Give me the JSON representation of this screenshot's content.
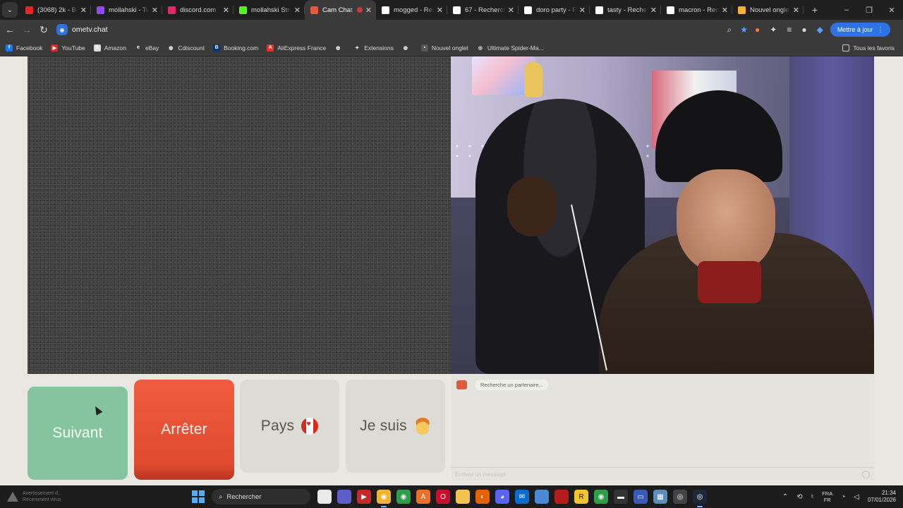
{
  "browser": {
    "tabs": [
      {
        "label": "(3068) 2k - Bo",
        "favicon_color": "#e12727"
      },
      {
        "label": "mollahski - Tw",
        "favicon_color": "#9146ff"
      },
      {
        "label": "discord.com",
        "favicon_color": "#e12a6e"
      },
      {
        "label": "mollahski Strea",
        "favicon_color": "#53fc18"
      },
      {
        "label": "Cam Chat",
        "favicon_color": "#e05a3d",
        "active": true
      },
      {
        "label": "mogged - Rech",
        "favicon_color": "#ffffff"
      },
      {
        "label": "67 - Recherche",
        "favicon_color": "#ffffff"
      },
      {
        "label": "doro party - Re",
        "favicon_color": "#ffffff"
      },
      {
        "label": "tasty - Recherc",
        "favicon_color": "#ffffff"
      },
      {
        "label": "macron - Rech",
        "favicon_color": "#ffffff"
      },
      {
        "label": "Nouvel onglet",
        "favicon_color": "#f2b233"
      }
    ],
    "new_tab_symbol": "+",
    "window_controls": [
      "–",
      "❐",
      "✕"
    ],
    "url": "ometv.chat",
    "update_button": "Mettre à jour",
    "bookmarks": [
      {
        "label": "Facebook",
        "color": "#1877f2",
        "glyph": "f"
      },
      {
        "label": "YouTube",
        "color": "#e12727",
        "glyph": "▶"
      },
      {
        "label": "Amazon",
        "color": "#dddddd",
        "glyph": "a"
      },
      {
        "label": "eBay",
        "color": "#3a3a3a",
        "glyph": "e"
      },
      {
        "label": "Cdiscount",
        "color": "#3a3a3a",
        "glyph": "◍"
      },
      {
        "label": "Booking.com",
        "color": "#003580",
        "glyph": "B"
      },
      {
        "label": "AliExpress France",
        "color": "#e43225",
        "glyph": "A"
      },
      {
        "label": "",
        "color": "#3a3a3a",
        "glyph": "◍"
      },
      {
        "label": "Extensions",
        "color": "#3a3a3a",
        "glyph": "✦"
      },
      {
        "label": "",
        "color": "#3a3a3a",
        "glyph": "◍"
      },
      {
        "label": "Nouvel onglet",
        "color": "#555555",
        "glyph": "▪"
      },
      {
        "label": "Ultimate Spider-Ma...",
        "color": "#3a3a3a",
        "glyph": "◎"
      }
    ],
    "all_bookmarks": "Tous les favoris"
  },
  "chat_app": {
    "buttons": {
      "next": "Suivant",
      "stop": "Arrêter",
      "country": "Pays",
      "gender": "Je suis"
    },
    "status_message": "Recherche un partenaire...",
    "input_placeholder": "Écrivez un message"
  },
  "taskbar": {
    "notification": [
      "Avertissement d...",
      "Recemment virus"
    ],
    "search_label": "Rechercher",
    "language": [
      "FRA",
      "FR"
    ],
    "time": "21:34",
    "date": "07/01/2026"
  },
  "colors": {
    "next_button": "#85c49e",
    "stop_button": "#e8503a",
    "accent": "#2f72e6"
  }
}
